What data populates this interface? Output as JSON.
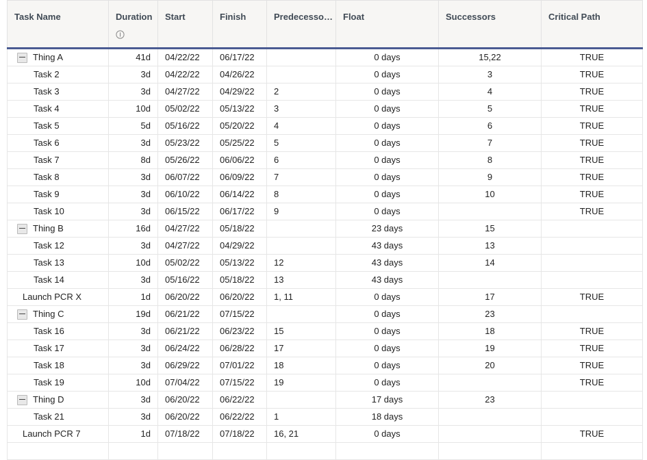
{
  "table": {
    "columns": [
      {
        "key": "name",
        "label": "Task Name",
        "align": "left"
      },
      {
        "key": "dur",
        "label": "Duration",
        "align": "right",
        "icon": "info-icon"
      },
      {
        "key": "start",
        "label": "Start",
        "align": "left"
      },
      {
        "key": "finish",
        "label": "Finish",
        "align": "left"
      },
      {
        "key": "pred",
        "label": "Predecesso…",
        "align": "left"
      },
      {
        "key": "float",
        "label": "Float",
        "align": "center"
      },
      {
        "key": "succ",
        "label": "Successors",
        "align": "center"
      },
      {
        "key": "crit",
        "label": "Critical Path",
        "align": "center"
      }
    ],
    "accent_color": "#4a5b92",
    "header_bg": "#f7f6f4",
    "grid_line_color": "#e6e6e6",
    "rows": [
      {
        "name": "Thing A",
        "level": 0,
        "collapsible": true,
        "dur": "41d",
        "start": "04/22/22",
        "finish": "06/17/22",
        "pred": "",
        "float": "0 days",
        "succ": "15,22",
        "crit": "TRUE"
      },
      {
        "name": "Task 2",
        "level": 1,
        "collapsible": false,
        "dur": "3d",
        "start": "04/22/22",
        "finish": "04/26/22",
        "pred": "",
        "float": "0 days",
        "succ": "3",
        "crit": "TRUE"
      },
      {
        "name": "Task 3",
        "level": 1,
        "collapsible": false,
        "dur": "3d",
        "start": "04/27/22",
        "finish": "04/29/22",
        "pred": "2",
        "float": "0 days",
        "succ": "4",
        "crit": "TRUE"
      },
      {
        "name": "Task 4",
        "level": 1,
        "collapsible": false,
        "dur": "10d",
        "start": "05/02/22",
        "finish": "05/13/22",
        "pred": "3",
        "float": "0 days",
        "succ": "5",
        "crit": "TRUE"
      },
      {
        "name": "Task 5",
        "level": 1,
        "collapsible": false,
        "dur": "5d",
        "start": "05/16/22",
        "finish": "05/20/22",
        "pred": "4",
        "float": "0 days",
        "succ": "6",
        "crit": "TRUE"
      },
      {
        "name": "Task 6",
        "level": 1,
        "collapsible": false,
        "dur": "3d",
        "start": "05/23/22",
        "finish": "05/25/22",
        "pred": "5",
        "float": "0 days",
        "succ": "7",
        "crit": "TRUE"
      },
      {
        "name": "Task 7",
        "level": 1,
        "collapsible": false,
        "dur": "8d",
        "start": "05/26/22",
        "finish": "06/06/22",
        "pred": "6",
        "float": "0 days",
        "succ": "8",
        "crit": "TRUE"
      },
      {
        "name": "Task 8",
        "level": 1,
        "collapsible": false,
        "dur": "3d",
        "start": "06/07/22",
        "finish": "06/09/22",
        "pred": "7",
        "float": "0 days",
        "succ": "9",
        "crit": "TRUE"
      },
      {
        "name": "Task 9",
        "level": 1,
        "collapsible": false,
        "dur": "3d",
        "start": "06/10/22",
        "finish": "06/14/22",
        "pred": "8",
        "float": "0 days",
        "succ": "10",
        "crit": "TRUE"
      },
      {
        "name": "Task 10",
        "level": 1,
        "collapsible": false,
        "dur": "3d",
        "start": "06/15/22",
        "finish": "06/17/22",
        "pred": "9",
        "float": "0 days",
        "succ": "",
        "crit": "TRUE"
      },
      {
        "name": "Thing B",
        "level": 0,
        "collapsible": true,
        "dur": "16d",
        "start": "04/27/22",
        "finish": "05/18/22",
        "pred": "",
        "float": "23 days",
        "succ": "15",
        "crit": ""
      },
      {
        "name": "Task 12",
        "level": 1,
        "collapsible": false,
        "dur": "3d",
        "start": "04/27/22",
        "finish": "04/29/22",
        "pred": "",
        "float": "43 days",
        "succ": "13",
        "crit": ""
      },
      {
        "name": "Task 13",
        "level": 1,
        "collapsible": false,
        "dur": "10d",
        "start": "05/02/22",
        "finish": "05/13/22",
        "pred": "12",
        "float": "43 days",
        "succ": "14",
        "crit": ""
      },
      {
        "name": "Task 14",
        "level": 1,
        "collapsible": false,
        "dur": "3d",
        "start": "05/16/22",
        "finish": "05/18/22",
        "pred": "13",
        "float": "43 days",
        "succ": "",
        "crit": ""
      },
      {
        "name": "Launch PCR X",
        "level": "ms",
        "collapsible": false,
        "dur": "1d",
        "start": "06/20/22",
        "finish": "06/20/22",
        "pred": "1, 11",
        "float": "0 days",
        "succ": "17",
        "crit": "TRUE"
      },
      {
        "name": "Thing C",
        "level": 0,
        "collapsible": true,
        "dur": "19d",
        "start": "06/21/22",
        "finish": "07/15/22",
        "pred": "",
        "float": "0 days",
        "succ": "23",
        "crit": ""
      },
      {
        "name": "Task 16",
        "level": 1,
        "collapsible": false,
        "dur": "3d",
        "start": "06/21/22",
        "finish": "06/23/22",
        "pred": "15",
        "float": "0 days",
        "succ": "18",
        "crit": "TRUE"
      },
      {
        "name": "Task 17",
        "level": 1,
        "collapsible": false,
        "dur": "3d",
        "start": "06/24/22",
        "finish": "06/28/22",
        "pred": "17",
        "float": "0 days",
        "succ": "19",
        "crit": "TRUE"
      },
      {
        "name": "Task 18",
        "level": 1,
        "collapsible": false,
        "dur": "3d",
        "start": "06/29/22",
        "finish": "07/01/22",
        "pred": "18",
        "float": "0 days",
        "succ": "20",
        "crit": "TRUE"
      },
      {
        "name": "Task 19",
        "level": 1,
        "collapsible": false,
        "dur": "10d",
        "start": "07/04/22",
        "finish": "07/15/22",
        "pred": "19",
        "float": "0 days",
        "succ": "",
        "crit": "TRUE"
      },
      {
        "name": "Thing D",
        "level": 0,
        "collapsible": true,
        "dur": "3d",
        "start": "06/20/22",
        "finish": "06/22/22",
        "pred": "",
        "float": "17 days",
        "succ": "23",
        "crit": ""
      },
      {
        "name": "Task 21",
        "level": 1,
        "collapsible": false,
        "dur": "3d",
        "start": "06/20/22",
        "finish": "06/22/22",
        "pred": "1",
        "float": "18 days",
        "succ": "",
        "crit": ""
      },
      {
        "name": "Launch PCR 7",
        "level": "ms",
        "collapsible": false,
        "dur": "1d",
        "start": "07/18/22",
        "finish": "07/18/22",
        "pred": "16, 21",
        "float": "0 days",
        "succ": "",
        "crit": "TRUE"
      },
      {
        "name": "",
        "level": 1,
        "collapsible": false,
        "dur": "",
        "start": "",
        "finish": "",
        "pred": "",
        "float": "",
        "succ": "",
        "crit": ""
      }
    ]
  }
}
